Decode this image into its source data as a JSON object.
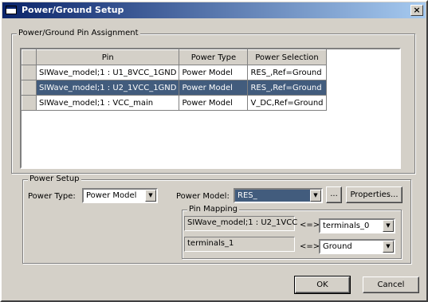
{
  "window": {
    "title": "Power/Ground Setup",
    "close_glyph": "×"
  },
  "pin_assignment": {
    "group_label": "Power/Ground Pin Assignment",
    "columns": [
      "Pin",
      "Power Type",
      "Power Selection"
    ],
    "rows": [
      {
        "pin": "SIWave_model;1 : U1_8VCC_1GND",
        "type": "Power Model",
        "selection": "RES_,Ref=Ground"
      },
      {
        "pin": "SIWave_model;1 : U2_1VCC_1GND",
        "type": "Power Model",
        "selection": "RES_,Ref=Ground"
      },
      {
        "pin": "SIWave_model;1 : VCC_main",
        "type": "Power Model",
        "selection": "V_DC,Ref=Ground"
      }
    ],
    "selected_row_index": 1
  },
  "power_setup": {
    "group_label": "Power Setup",
    "power_type_label": "Power Type:",
    "power_type_value": "Power Model",
    "power_model_label": "Power Model:",
    "power_model_value": "RES_",
    "browse_button": "...",
    "properties_button": "Properties...",
    "pin_mapping": {
      "group_label": "Pin Mapping",
      "rows": [
        {
          "left": "SIWave_model;1 : U2_1VCC",
          "arrow": "<=>",
          "right": "terminals_0"
        },
        {
          "left": "terminals_1",
          "arrow": "<=>",
          "right": "Ground"
        }
      ]
    }
  },
  "buttons": {
    "ok": "OK",
    "cancel": "Cancel"
  },
  "icons": {
    "dropdown": "chevron-down-icon",
    "close": "close-icon",
    "window": "window-icon"
  },
  "colors": {
    "title_start": "#0a246a",
    "title_end": "#a6caf0",
    "selection": "#425c7d",
    "face": "#d4d0c8"
  }
}
